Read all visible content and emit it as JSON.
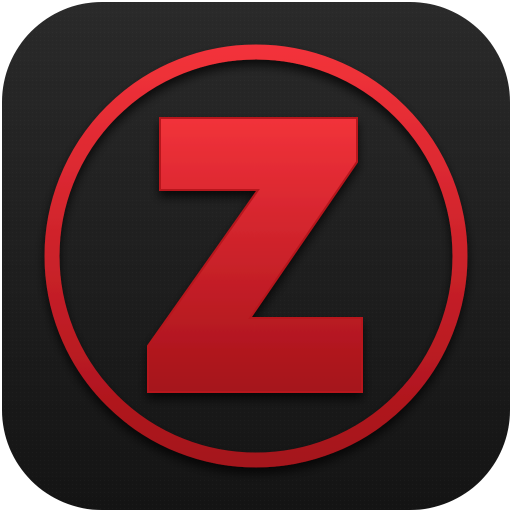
{
  "app_icon": {
    "icon_name": "z-letter-circle-icon",
    "letter": "Z",
    "colors": {
      "background_top": "#2a2a2a",
      "background_bottom": "#141414",
      "red_light": "#f2323a",
      "red_dark": "#a5121a",
      "shadow": "#000000"
    }
  }
}
